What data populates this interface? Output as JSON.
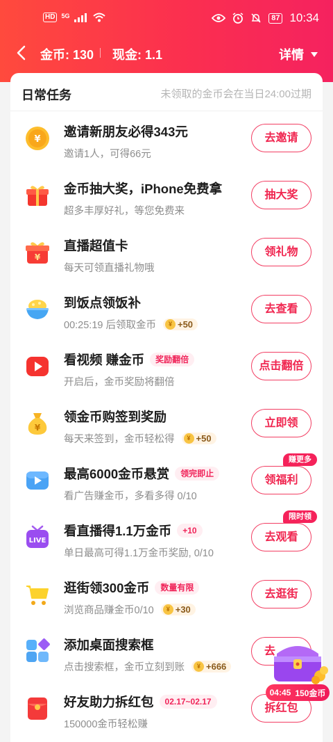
{
  "status_bar": {
    "hd": "HD",
    "network": "5G",
    "battery": "87",
    "time": "10:34"
  },
  "header": {
    "coins_label": "金币: 130",
    "cash_label": "现金: 1.1",
    "detail_label": "详情"
  },
  "card": {
    "title": "日常任务",
    "note": "未领取的金币会在当日24:00过期"
  },
  "tasks": [
    {
      "name": "邀请新朋友必得343元",
      "desc": "邀请1人，可得66元",
      "button": "去邀请",
      "icon": "coin-icon"
    },
    {
      "name": "金币抽大奖，iPhone免费拿",
      "desc": "超多丰厚好礼，等您免费来",
      "button": "抽大奖",
      "icon": "gift-box-icon"
    },
    {
      "name": "直播超值卡",
      "desc": "每天可领直播礼物哦",
      "button": "领礼物",
      "icon": "gift-card-icon"
    },
    {
      "name": "到饭点领饭补",
      "desc": "00:25:19 后领取金币",
      "reward": "+50",
      "button": "去查看",
      "icon": "rice-bowl-icon"
    },
    {
      "name": "看视频 赚金币",
      "tag": "奖励翻倍",
      "desc": "开启后，金币奖励将翻倍",
      "button": "点击翻倍",
      "icon": "video-play-icon"
    },
    {
      "name": "领金币购签到奖励",
      "desc": "每天来签到，金币轻松得",
      "reward": "+50",
      "button": "立即领",
      "icon": "money-bag-icon"
    },
    {
      "name": "最高6000金币悬赏",
      "tag": "领完即止",
      "desc": "看广告赚金币，多看多得 0/10",
      "button": "领福利",
      "bubble": "赚更多",
      "icon": "ad-play-icon"
    },
    {
      "name": "看直播得1.1万金币",
      "tag": "+10",
      "desc": "单日最高可得1.1万金币奖励,   0/10",
      "button": "去观看",
      "bubble": "限时领",
      "icon": "live-tv-icon"
    },
    {
      "name": "逛街领300金币",
      "tag": "数量有限",
      "desc": "浏览商品赚金币0/10",
      "reward": "+30",
      "button": "去逛街",
      "icon": "shopping-cart-icon"
    },
    {
      "name": "添加桌面搜索框",
      "desc": "点击搜索框，金币立刻到账",
      "reward": "+666",
      "button": "去",
      "icon": "widget-grid-icon"
    },
    {
      "name": "好友助力拆红包",
      "tag": "02.17~02.17",
      "desc": "150000金币轻松赚",
      "button": "拆红包",
      "icon": "red-packet-icon"
    }
  ],
  "floating": {
    "timer": "04:45",
    "amount": "150金币"
  },
  "colors": {
    "brand": "#f5225f",
    "header_start": "#ff4a3d",
    "button_text": "#f0254f",
    "tag_bg": "#ffeef2"
  }
}
